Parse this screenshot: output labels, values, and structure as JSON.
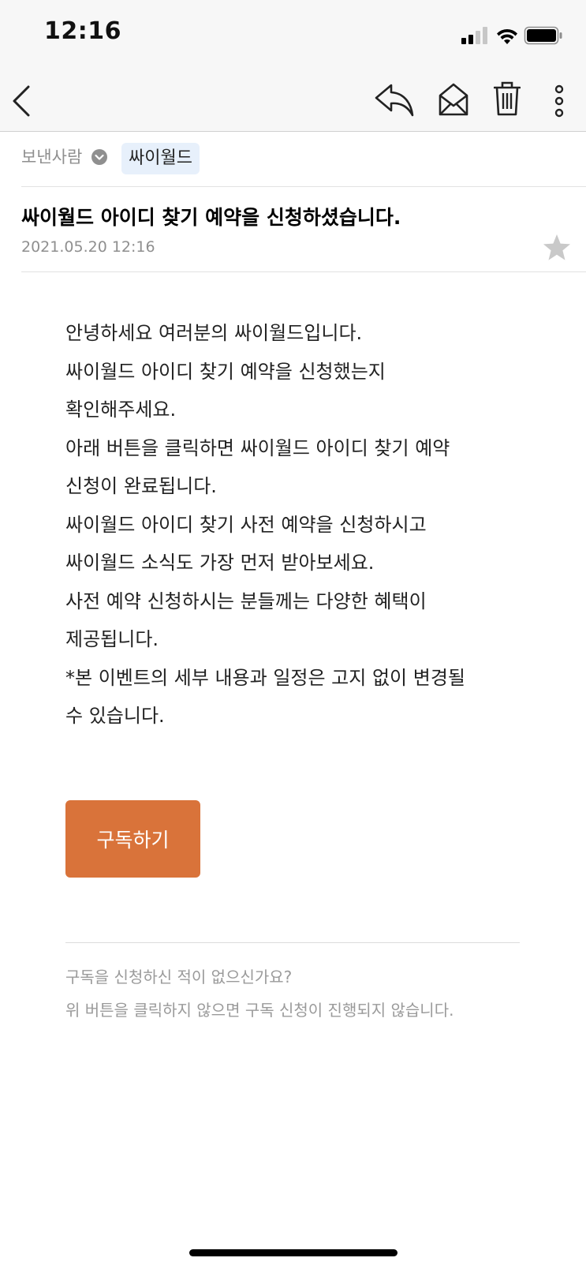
{
  "status_bar": {
    "time": "12:16"
  },
  "nav": {
    "icons": [
      "chevron-left-icon",
      "reply-icon",
      "mail-open-icon",
      "trash-icon",
      "more-vertical-icon"
    ]
  },
  "sender": {
    "label": "보낸사람",
    "name": "싸이월드"
  },
  "email": {
    "subject": "싸이월드 아이디 찾기 예약을 신청하셨습니다.",
    "date": "2021.05.20 12:16",
    "body_lines": [
      "안녕하세요 여러분의 싸이월드입니다.",
      "싸이월드 아이디 찾기 예약을 신청했는지",
      "확인해주세요.",
      "아래 버튼을 클릭하면 싸이월드 아이디 찾기 예약",
      "신청이 완료됩니다.",
      "싸이월드 아이디 찾기 사전 예약을 신청하시고",
      "싸이월드 소식도 가장 먼저 받아보세요.",
      "사전 예약 신청하시는 분들께는 다양한 혜택이",
      "제공됩니다.",
      "*본 이벤트의 세부 내용과 일정은 고지 없이 변경될",
      "수 있습니다."
    ],
    "button_label": "구독하기",
    "footer_lines": [
      "구독을 신청하신 적이 없으신가요?",
      "위 버튼을 클릭하지 않으면 구독 신청이 진행되지 않습니다."
    ]
  },
  "colors": {
    "accent": "#d9733a",
    "chip_bg": "#e7f0fb"
  }
}
